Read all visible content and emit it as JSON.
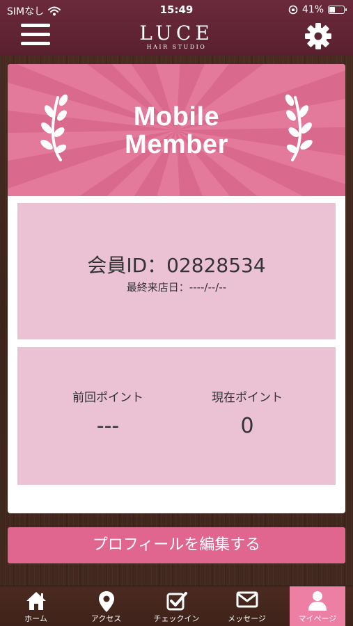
{
  "status_bar": {
    "carrier": "SIMなし",
    "time": "15:49",
    "battery_percent": "41%",
    "battery_level": 0.41
  },
  "header": {
    "logo_name": "LUCE",
    "logo_sub": "HAIR STUDIO"
  },
  "card": {
    "banner_title_line1": "Mobile",
    "banner_title_line2": "Member",
    "member_id_line": "会員ID：02828534",
    "last_visit_line": "最終来店日：----/--/--",
    "previous_points_label": "前回ポイント",
    "previous_points_value": "---",
    "current_points_label": "現在ポイント",
    "current_points_value": "0"
  },
  "edit_profile_label": "プロフィールを編集する",
  "tabs": [
    {
      "label": "ホーム",
      "icon": "home-icon"
    },
    {
      "label": "アクセス",
      "icon": "map-pin-icon"
    },
    {
      "label": "チェックイン",
      "icon": "checkbox-icon"
    },
    {
      "label": "メッセージ",
      "icon": "envelope-icon"
    },
    {
      "label": "マイページ",
      "icon": "person-icon",
      "active": true
    }
  ],
  "colors": {
    "banner_pink": "#e3799b",
    "panel_pink": "#ebc1d4",
    "button_pink": "#e0658f",
    "header_maroon": "#6a2a3b"
  }
}
